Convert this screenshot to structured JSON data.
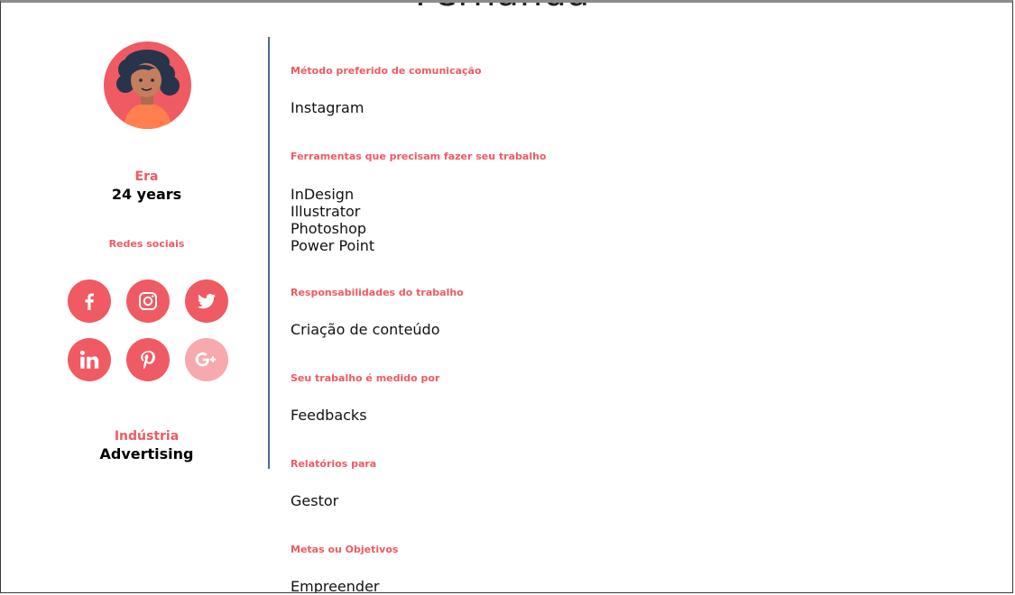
{
  "persona": {
    "name_partial": "Fernanda",
    "age": {
      "label": "Era",
      "value": "24 years"
    },
    "social": {
      "label": "Redes sociais",
      "networks": [
        {
          "name": "facebook",
          "icon": "facebook-icon",
          "enabled": true
        },
        {
          "name": "instagram",
          "icon": "instagram-icon",
          "enabled": true
        },
        {
          "name": "twitter",
          "icon": "twitter-icon",
          "enabled": true
        },
        {
          "name": "linkedin",
          "icon": "linkedin-icon",
          "enabled": true
        },
        {
          "name": "pinterest",
          "icon": "pinterest-icon",
          "enabled": true
        },
        {
          "name": "google-plus",
          "icon": "google-plus-icon",
          "enabled": false
        }
      ]
    },
    "industry": {
      "label": "Indústria",
      "value": "Advertising"
    }
  },
  "details": {
    "communication": {
      "label": "Método preferido de comunicação",
      "value": "Instagram"
    },
    "tools": {
      "label": "Ferramentas que precisam fazer seu trabalho",
      "items": [
        "InDesign",
        "Illustrator",
        "Photoshop",
        "Power Point"
      ]
    },
    "responsibilities": {
      "label": "Responsabilidades do trabalho",
      "value": "Criação de conteúdo"
    },
    "measured_by": {
      "label": "Seu trabalho é medido por",
      "value": "Feedbacks"
    },
    "reports_to": {
      "label": "Relatórios para",
      "value": "Gestor"
    },
    "goals": {
      "label": "Metas ou Objetivos",
      "value": "Empreender"
    }
  },
  "colors": {
    "accent": "#ef5a63",
    "accent_disabled": "#f8a9ad",
    "divider": "#4a6a8f"
  }
}
